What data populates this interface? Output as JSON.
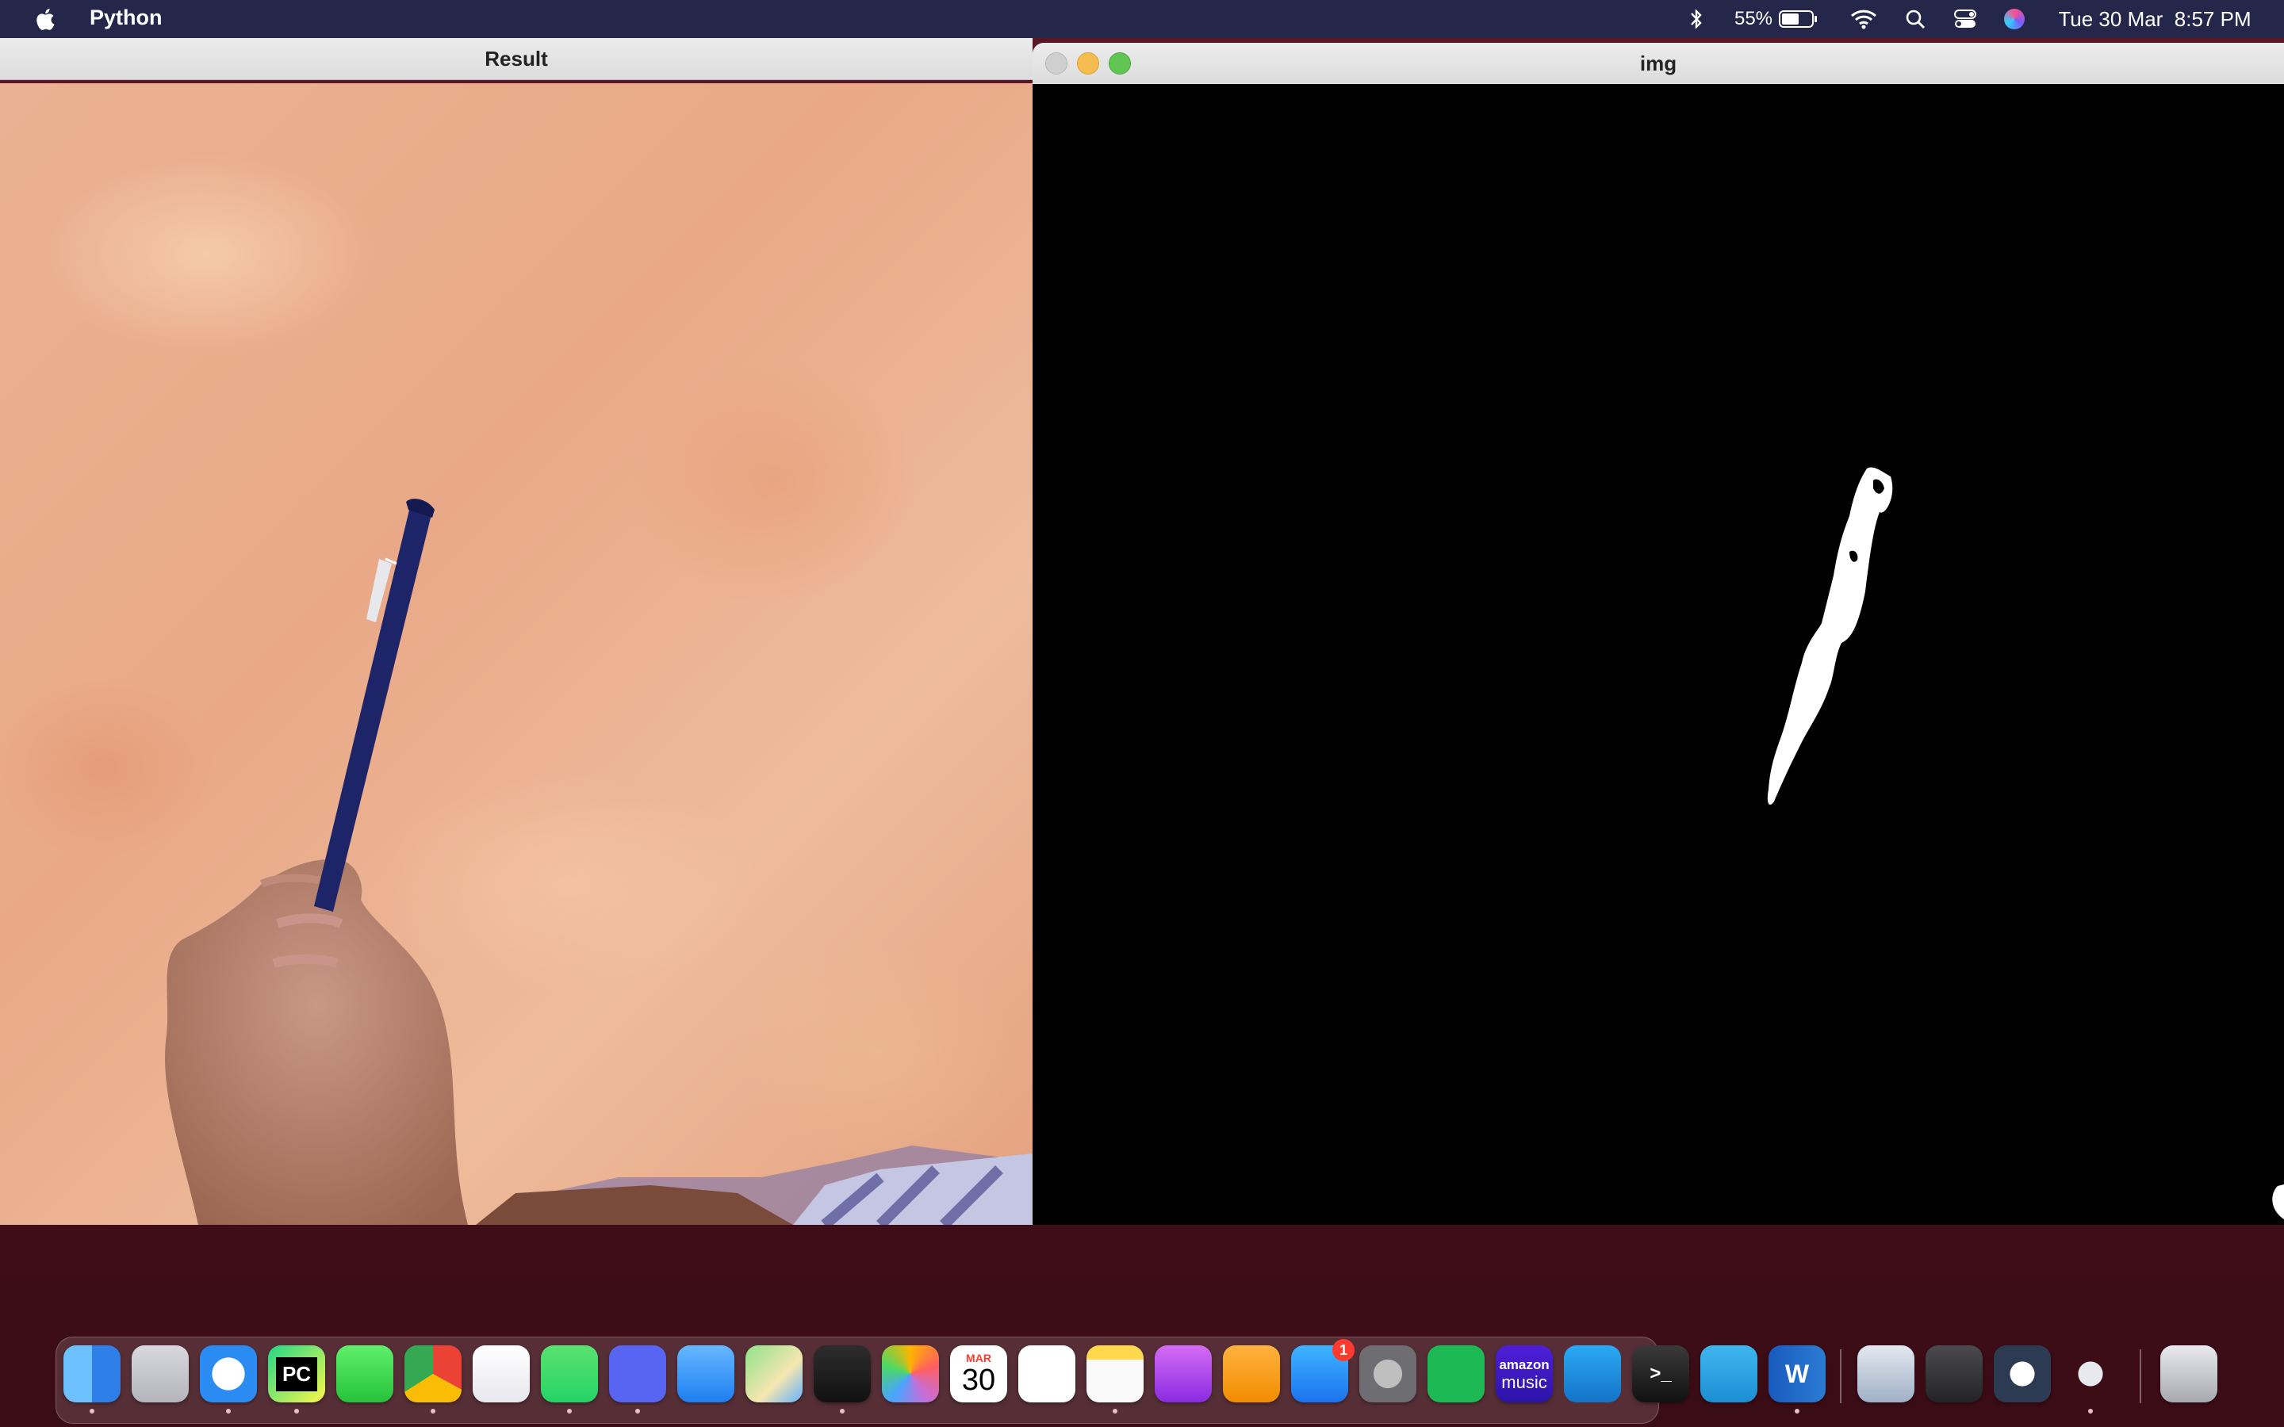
{
  "menubar": {
    "app_name": "Python",
    "battery": "55%",
    "datetime": "Tue 30 Mar  8:57 PM",
    "icons": [
      "apple-icon",
      "bluetooth-icon",
      "battery-icon",
      "wifi-icon",
      "search-icon",
      "control-center-icon",
      "siri-icon"
    ]
  },
  "windows": {
    "result": {
      "title": "Result"
    },
    "img": {
      "title": "img"
    }
  },
  "dock": {
    "apps": [
      {
        "name": "Finder",
        "icon": "finder-icon",
        "running": true
      },
      {
        "name": "Launchpad",
        "icon": "launchpad-icon",
        "running": false
      },
      {
        "name": "Safari",
        "icon": "safari-icon",
        "running": true
      },
      {
        "name": "PyCharm",
        "icon": "pycharm-icon",
        "label": "PC",
        "running": true
      },
      {
        "name": "Messages",
        "icon": "messages-icon",
        "running": false
      },
      {
        "name": "Google Chrome",
        "icon": "chrome-icon",
        "running": true
      },
      {
        "name": "Xcode",
        "icon": "xcode-icon",
        "running": false
      },
      {
        "name": "WhatsApp",
        "icon": "whatsapp-icon",
        "running": true
      },
      {
        "name": "Discord",
        "icon": "discord-icon",
        "running": true
      },
      {
        "name": "Mail",
        "icon": "mail-icon",
        "running": false
      },
      {
        "name": "Maps",
        "icon": "maps-icon",
        "running": false
      },
      {
        "name": "Activity Monitor",
        "icon": "activity-monitor-icon",
        "running": true
      },
      {
        "name": "Photos",
        "icon": "photos-icon",
        "running": false
      },
      {
        "name": "Calendar",
        "icon": "calendar-icon",
        "month": "MAR",
        "day": "30",
        "running": false
      },
      {
        "name": "Reminders",
        "icon": "reminders-icon",
        "running": false
      },
      {
        "name": "Notes",
        "icon": "notes-icon",
        "running": true
      },
      {
        "name": "Podcasts",
        "icon": "podcasts-icon",
        "running": false
      },
      {
        "name": "Pages",
        "icon": "pages-icon",
        "running": false
      },
      {
        "name": "App Store",
        "icon": "app-store-icon",
        "badge": "1",
        "running": false
      },
      {
        "name": "System Preferences",
        "icon": "system-preferences-icon",
        "running": false
      },
      {
        "name": "Spotify",
        "icon": "spotify-icon",
        "running": false
      },
      {
        "name": "Amazon Music",
        "icon": "amazon-music-icon",
        "label_top": "amazon",
        "label_bottom": "music",
        "running": false
      },
      {
        "name": "Visual Studio Code",
        "icon": "vscode-icon",
        "running": false
      },
      {
        "name": "Terminal",
        "icon": "terminal-icon",
        "label": ">_",
        "running": false
      },
      {
        "name": "Telegram",
        "icon": "telegram-icon",
        "running": false
      },
      {
        "name": "Microsoft Word",
        "icon": "word-icon",
        "label": "W",
        "running": true
      },
      {
        "name": "Preview",
        "icon": "preview-icon",
        "running": false
      },
      {
        "name": "Calculator",
        "icon": "calculator-icon",
        "running": false
      },
      {
        "name": "QuickTime Player",
        "icon": "quicktime-icon",
        "running": false
      },
      {
        "name": "Python Launcher",
        "icon": "rocket-icon",
        "running": true
      },
      {
        "name": "Trash",
        "icon": "trash-icon",
        "running": false
      }
    ]
  }
}
